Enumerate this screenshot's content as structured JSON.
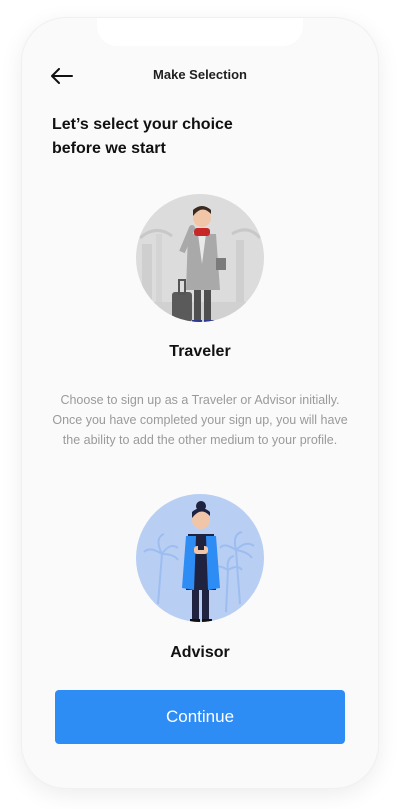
{
  "header": {
    "title": "Make Selection",
    "back_icon": "arrow-left-icon"
  },
  "heading": {
    "line1": "Let’s select your choice",
    "line2": "before we start"
  },
  "options": [
    {
      "label": "Traveler",
      "illustration": "traveler-illustration"
    },
    {
      "label": "Advisor",
      "illustration": "advisor-illustration"
    }
  ],
  "description": "Choose to sign up as a Traveler or Advisor initially. Once you have completed your sign up, you will have the ability to add the other medium to your profile.",
  "continue_label": "Continue",
  "colors": {
    "primary": "#2e8cf5",
    "traveler_bg": "#dcdcdc",
    "advisor_bg": "#b8cff3",
    "muted_text": "#9a9a9a"
  }
}
